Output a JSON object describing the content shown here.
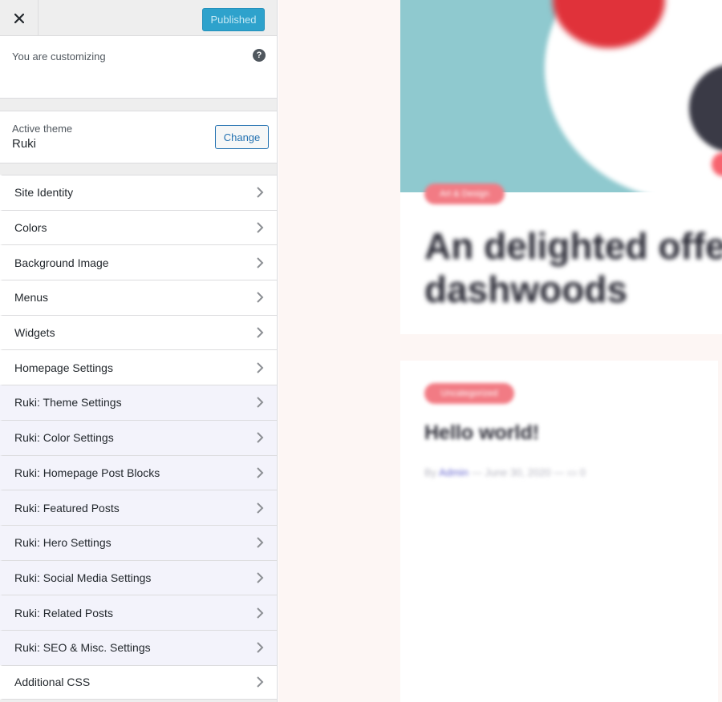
{
  "header": {
    "close_icon": "close-icon",
    "publish_label": "Published"
  },
  "info": {
    "label": "You are customizing",
    "help_icon": "help-icon",
    "help_glyph": "?"
  },
  "theme": {
    "label": "Active theme",
    "name": "Ruki",
    "change_label": "Change"
  },
  "menu": [
    {
      "label": "Site Identity"
    },
    {
      "label": "Colors"
    },
    {
      "label": "Background Image"
    },
    {
      "label": "Menus"
    },
    {
      "label": "Widgets"
    },
    {
      "label": "Homepage Settings"
    },
    {
      "label": "Ruki: Theme Settings"
    },
    {
      "label": "Ruki: Color Settings"
    },
    {
      "label": "Ruki: Homepage Post Blocks"
    },
    {
      "label": "Ruki: Featured Posts"
    },
    {
      "label": "Ruki: Hero Settings"
    },
    {
      "label": "Ruki: Social Media Settings"
    },
    {
      "label": "Ruki: Related Posts"
    },
    {
      "label": "Ruki: SEO & Misc. Settings"
    },
    {
      "label": "Additional CSS"
    }
  ],
  "preview": {
    "post1": {
      "tag": "Art & Design",
      "title_line1": "An delighted offe",
      "title_line2": "dashwoods"
    },
    "post2": {
      "tag": "Uncategorized",
      "title": "Hello world!",
      "by": "By",
      "author": "Admin",
      "date": "June 30, 2020",
      "comments": "0"
    }
  },
  "colors": {
    "publish_bg": "#2ea2cc",
    "accent": "#2271b1",
    "theme_section_bg": "#f3f3fb",
    "preview_bg": "#fdf6f4",
    "tag_color": "#f27b84"
  }
}
